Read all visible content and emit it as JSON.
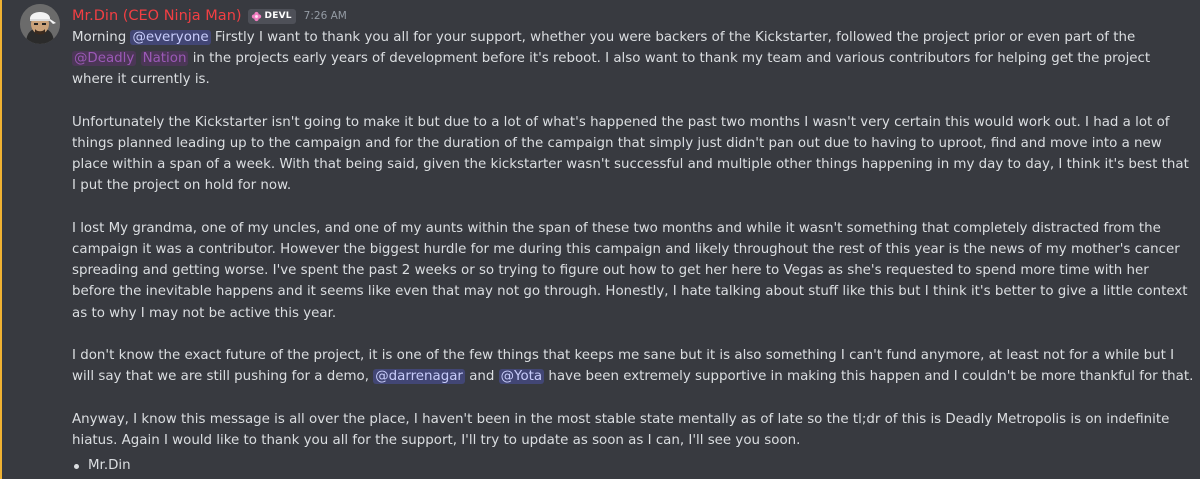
{
  "message": {
    "author": {
      "name": "Mr.Din (CEO Ninja Man)",
      "name_color": "#f23f43",
      "tag_icon": "pink-flower-icon",
      "tag": "DEVL"
    },
    "timestamp": "7:26 AM",
    "p1": {
      "t1": "Morning ",
      "mention_everyone": "@everyone",
      "t2": " Firstly I want to thank you all for your support, whether you were backers of the Kickstarter, followed the project prior or even part of the ",
      "mention_deadly": "@Deadly",
      "mention_nation": "Nation",
      "t3": " in the projects early years of development before it's reboot. I also want to thank my team and various contributors for helping get the project where it currently is."
    },
    "p2": "Unfortunately the Kickstarter isn't going to make it but due to a lot of what's happened the past two months I wasn't very certain this would work out. I had a lot of things planned leading up to the campaign and for the duration of the campaign that simply just didn't pan out due to having to uproot, find and move into a new place within a span of a week. With that being said, given the kickstarter wasn't successful and multiple other things happening in my day to day, I think it's best that I put the project on hold for now.",
    "p3": "I lost My grandma, one of my uncles, and one of my aunts within the span of these two months and while it wasn't something that completely distracted from the campaign it was a contributor. However the biggest hurdle for me during this campaign and likely throughout the rest of this year is the news of my mother's cancer spreading and getting worse. I've spent the past 2 weeks or so trying to figure out how to get her here to Vegas as she's requested to spend more time with her before the inevitable happens and it seems like even that may not go through. Honestly, I hate talking about stuff like this but I think it's better to give a little context as to why I may not be active this year.",
    "p4": {
      "t1": "I don't know the exact future of the project, it is one of the few things that keeps me sane but it is also something I can't fund anymore, at least not for a while but I will say that we are still pushing for a demo, ",
      "mention_darren": "@darrenagar",
      "t2": " and ",
      "mention_yota": "@Yota",
      "t3": " have been extremely supportive in making this happen and I couldn't be more thankful for that."
    },
    "p5": "Anyway, I know this message is all over the place, I haven't been in the most stable state mentally as of late so the tl;dr of this is Deadly Metropolis is on indefinite hiatus. Again I would like to thank you all for the support, I'll try to update as soon as I can, I'll see you soon.",
    "signature": "Mr.Din"
  },
  "colors": {
    "background": "#383a40",
    "highlight_bar": "#f0b232",
    "text": "#dbdee1",
    "mention_user": "#c9cdfb",
    "mention_role": "#9b59b6",
    "timestamp": "#949ba4"
  }
}
